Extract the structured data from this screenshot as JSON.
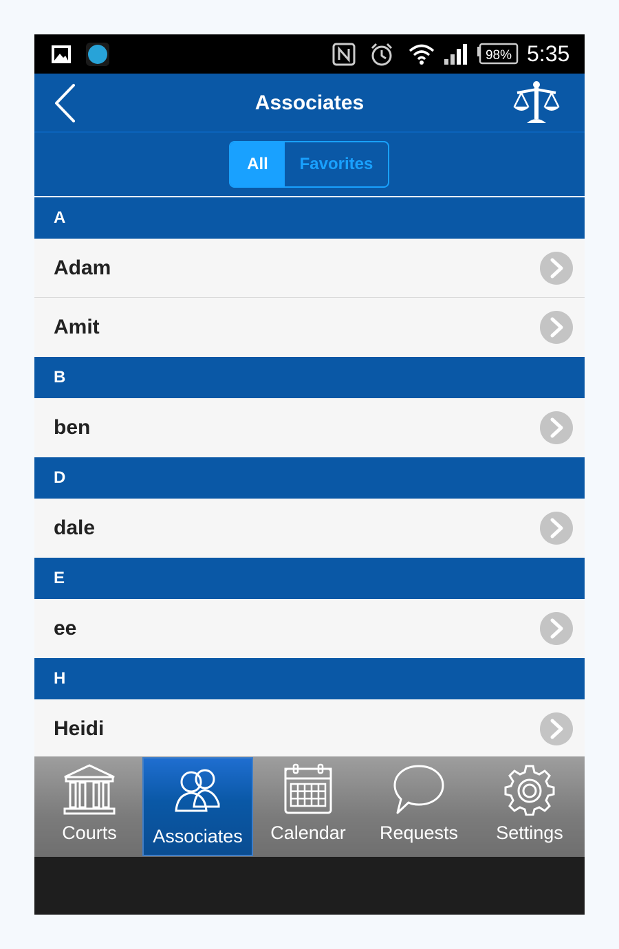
{
  "status_bar": {
    "battery": "98%",
    "time": "5:35",
    "icons": [
      "gallery-icon",
      "app-dot-icon",
      "nfc-icon",
      "alarm-icon",
      "wifi-icon",
      "signal-icon",
      "battery-icon"
    ]
  },
  "nav": {
    "title": "Associates",
    "left_icon": "back-chevron-icon",
    "right_icon": "scales-icon"
  },
  "segments": {
    "all": "All",
    "favorites": "Favorites",
    "selected": "All"
  },
  "list": [
    {
      "header": "A",
      "items": [
        "Adam",
        "Amit"
      ]
    },
    {
      "header": "B",
      "items": [
        "ben"
      ]
    },
    {
      "header": "D",
      "items": [
        "dale"
      ]
    },
    {
      "header": "E",
      "items": [
        "ee"
      ]
    },
    {
      "header": "H",
      "items": [
        "Heidi"
      ]
    }
  ],
  "tabs": [
    {
      "label": "Courts",
      "icon": "courthouse-icon"
    },
    {
      "label": "Associates",
      "icon": "people-icon",
      "active": true
    },
    {
      "label": "Calendar",
      "icon": "calendar-icon"
    },
    {
      "label": "Requests",
      "icon": "speech-bubble-icon"
    },
    {
      "label": "Settings",
      "icon": "gear-icon"
    }
  ],
  "colors": {
    "primary_blue": "#0a58a6",
    "accent_blue": "#19a1ff",
    "row_bg": "#f6f6f6",
    "chevron_gray": "#c4c4c4"
  }
}
